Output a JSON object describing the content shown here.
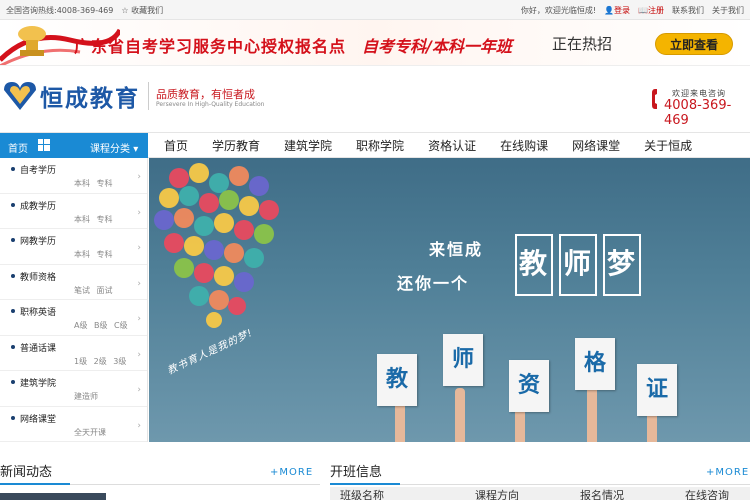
{
  "topbar": {
    "hotline": "全国咨询热线:4008-369-469",
    "bookmark": "收藏我们",
    "welcome": "你好，欢迎光临恒成!",
    "login": "登录",
    "register": "注册",
    "contact": "联系我们",
    "about": "关于我们"
  },
  "promo": {
    "line1": "广东省自考学习服务中心授权报名点",
    "line2": "自考专科/本科一年班",
    "line3": "正在热招",
    "cta": "立即查看"
  },
  "header": {
    "logo": "恒成教育",
    "slogan": "品质教育，有恒者成",
    "slogan_en": "Persevere In High-Quality Education",
    "phone_label": "欢迎来电咨询",
    "phone": "4008-369-469"
  },
  "nav": {
    "home": "首页",
    "category": "课程分类",
    "items": [
      "首页",
      "学历教育",
      "建筑学院",
      "职称学院",
      "资格认证",
      "在线购课",
      "网络课堂",
      "关于恒成"
    ]
  },
  "sidebar": {
    "items": [
      {
        "title": "自考学历",
        "sub": "本科 专科"
      },
      {
        "title": "成教学历",
        "sub": "本科 专科"
      },
      {
        "title": "网教学历",
        "sub": "本科 专科"
      },
      {
        "title": "教师资格",
        "sub": "笔试 面试"
      },
      {
        "title": "职称英语",
        "sub": "A级 B级 C级"
      },
      {
        "title": "普通话课",
        "sub": "1级 2级 3级"
      },
      {
        "title": "建筑学院",
        "sub": "建造师"
      },
      {
        "title": "网络课堂",
        "sub": "全天开课"
      }
    ]
  },
  "hero": {
    "line1": "来恒成",
    "line2": "还你一个",
    "dream": [
      "教",
      "师",
      "梦"
    ],
    "tag": "教书育人是我的梦!",
    "cards": [
      "教",
      "师",
      "资",
      "格",
      "证"
    ]
  },
  "news": {
    "title": "新闻动态",
    "more": "+MORE"
  },
  "classes": {
    "title": "开班信息",
    "more": "+MORE",
    "columns": [
      "班级名称",
      "课程方向",
      "报名情况",
      "在线咨询"
    ]
  },
  "colors": {
    "accent": "#1a8ad4",
    "brand_red": "#c8171e",
    "logo_blue": "#1d58a6"
  }
}
